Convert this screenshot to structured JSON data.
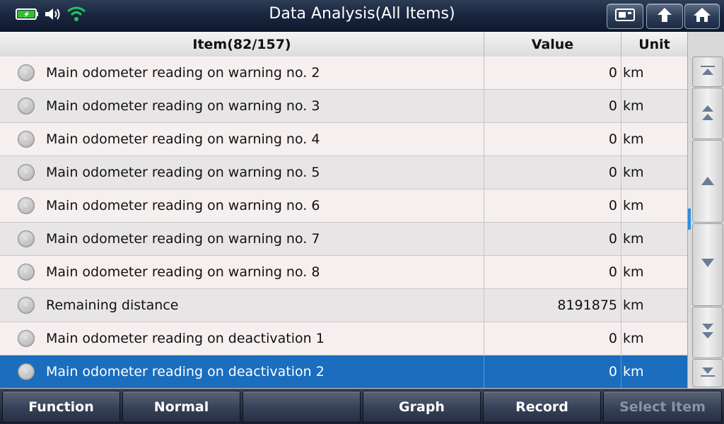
{
  "header": {
    "title": "Data Analysis(All Items)",
    "icons": [
      "battery-icon",
      "speaker-icon",
      "wifi-icon"
    ],
    "buttons": [
      "screenshot-button",
      "back-button",
      "home-button"
    ]
  },
  "table": {
    "columns": {
      "item": "Item(82/157)",
      "value": "Value",
      "unit": "Unit"
    },
    "rows": [
      {
        "item": "Main odometer reading on warning no. 2",
        "value": "0",
        "unit": "km"
      },
      {
        "item": "Main odometer reading on warning no. 3",
        "value": "0",
        "unit": "km"
      },
      {
        "item": "Main odometer reading on warning no. 4",
        "value": "0",
        "unit": "km"
      },
      {
        "item": "Main odometer reading on warning no. 5",
        "value": "0",
        "unit": "km"
      },
      {
        "item": "Main odometer reading on warning no. 6",
        "value": "0",
        "unit": "km"
      },
      {
        "item": "Main odometer reading on warning no. 7",
        "value": "0",
        "unit": "km"
      },
      {
        "item": "Main odometer reading on warning no. 8",
        "value": "0",
        "unit": "km"
      },
      {
        "item": "Remaining distance",
        "value": "8191875",
        "unit": "km"
      },
      {
        "item": "Main odometer reading on deactivation 1",
        "value": "0",
        "unit": "km"
      },
      {
        "item": "Main odometer reading on deactivation 2",
        "value": "0",
        "unit": "km"
      }
    ],
    "selected_row": 9
  },
  "scroll": {
    "buttons": [
      "scroll-top-icon",
      "page-up-icon",
      "line-up-icon",
      "line-down-icon",
      "page-down-icon",
      "scroll-bottom-icon"
    ]
  },
  "footer": {
    "function": "Function",
    "normal": "Normal",
    "empty": "",
    "graph": "Graph",
    "record": "Record",
    "select_item": "Select Item"
  },
  "colors": {
    "titlebar": "#1a2740",
    "selected_row": "#1b6dbd",
    "scroll_indicator": "#2e8fe0",
    "wifi": "#22c55e",
    "battery": "#31c12a"
  }
}
